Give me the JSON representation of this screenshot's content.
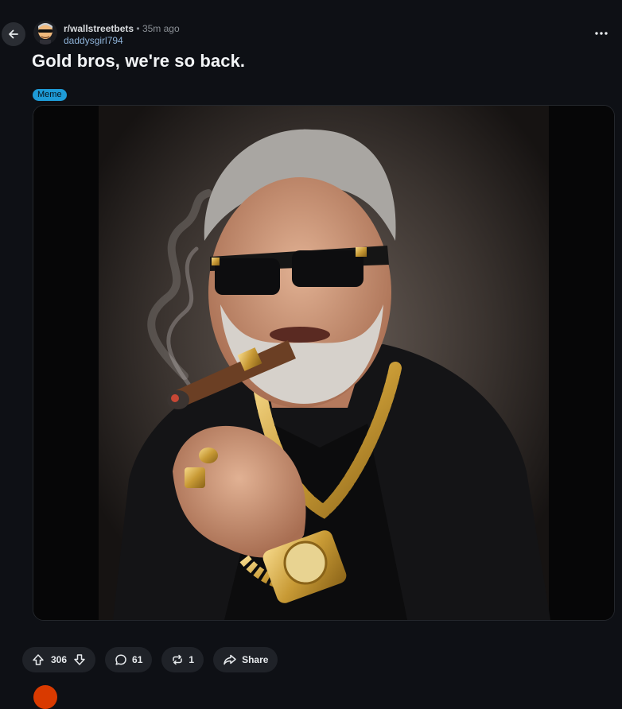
{
  "post": {
    "subreddit": "r/wallstreetbets",
    "separator": "•",
    "time_ago": "35m ago",
    "author": "daddysgirl794",
    "title": "Gold bros, we're so back.",
    "flair": "Meme"
  },
  "actions": {
    "upvotes": "306",
    "comments": "61",
    "reposts": "1",
    "share_label": "Share"
  },
  "icons": [
    "back-arrow-icon",
    "more-options-icon",
    "upvote-icon",
    "downvote-icon",
    "comment-icon",
    "repost-icon",
    "share-icon"
  ],
  "colors": {
    "background": "#0e1015",
    "flair": "#1e9bd7",
    "pill": "#1f2228"
  }
}
